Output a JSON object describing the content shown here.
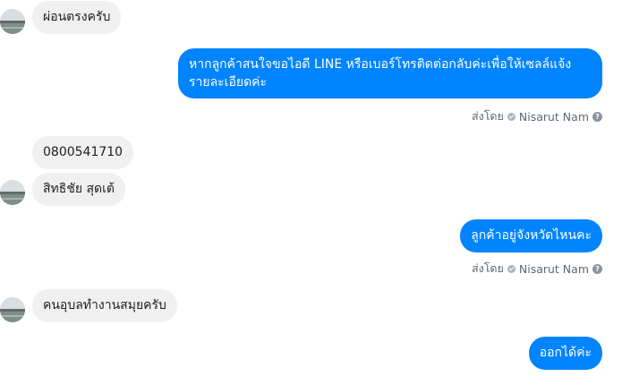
{
  "messages": {
    "m1": {
      "text": "ผ่อนตรงครับ"
    },
    "m2": {
      "text": "หากลูกค้าสนใจขอไอดี LINE หรือเบอร์โทรติดต่อกลับค่ะเพื่อให้เซลล์แจ้งรายละเอียดค่ะ",
      "sent_by_label": "ส่งโดย",
      "sender": "Nisarut Nam"
    },
    "m3": {
      "text": "0800541710"
    },
    "m4": {
      "text": "สิทธิชัย สุดเต้"
    },
    "m5": {
      "text": "ลูกค้าอยู่จังหวัดไหนคะ",
      "sent_by_label": "ส่งโดย",
      "sender": "Nisarut Nam"
    },
    "m6": {
      "text": "คนอุบลทำงานสมุยครับ"
    },
    "m7": {
      "text": "ออกได้ค่ะ"
    }
  },
  "icons": {
    "avatar": "contact-avatar",
    "sent_status": "check-circle-icon",
    "help": "question-icon"
  },
  "colors": {
    "outgoing_bubble": "#0084ff",
    "incoming_bubble": "#f1f0f0",
    "meta_text": "#606770"
  }
}
